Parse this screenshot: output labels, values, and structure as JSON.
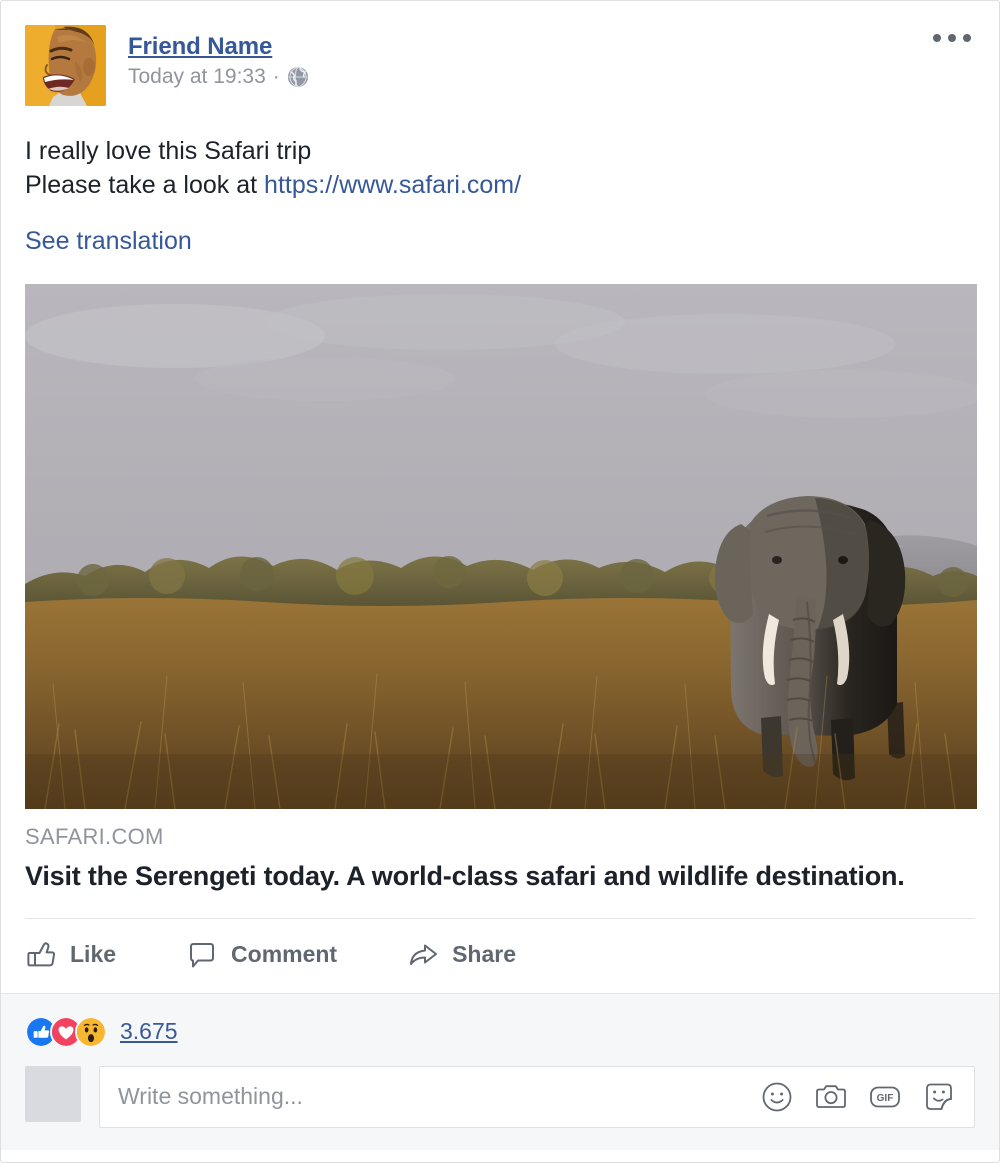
{
  "post": {
    "author": {
      "name": "Friend Name",
      "avatar_alt": "profile-photo-laughing-woman",
      "avatar_bg": "#e8a020"
    },
    "meta": {
      "timestamp": "Today at 19:33",
      "separator": "·",
      "privacy_icon": "globe-icon",
      "privacy_label": "Public"
    },
    "more_menu_label": "More options",
    "message": {
      "line1": "I really love this Safari trip",
      "line2_prefix": "Please take a look at ",
      "link_text": "https://www.safari.com/",
      "translate_label": "See translation"
    },
    "photo": {
      "alt": "elephant-in-savanna-grassland",
      "sky_color": "#b4b2b7",
      "grass_color": "#8a6432",
      "tree_color": "#6e6a43"
    },
    "attachment": {
      "domain": "SAFARI.COM",
      "title": "Visit the Serengeti today. A world-class safari and wildlife destination."
    },
    "actions": [
      {
        "key": "like",
        "label": "Like",
        "icon": "thumbs-up-icon"
      },
      {
        "key": "comment",
        "label": "Comment",
        "icon": "comment-bubble-icon"
      },
      {
        "key": "share",
        "label": "Share",
        "icon": "share-arrow-icon"
      }
    ],
    "reactions": {
      "count": "3.675",
      "items": [
        {
          "key": "like",
          "icon": "reaction-like-icon",
          "color": "#1877f2"
        },
        {
          "key": "love",
          "icon": "reaction-love-icon",
          "color": "#f3425f"
        },
        {
          "key": "wow",
          "icon": "reaction-wow-icon",
          "color": "#f7b125"
        }
      ]
    },
    "composer": {
      "placeholder": "Write something...",
      "value": "",
      "avatar_alt": "your-profile-photo",
      "tools": [
        {
          "key": "emoji",
          "icon": "emoji-smiley-icon",
          "label": "Emoji"
        },
        {
          "key": "photo",
          "icon": "camera-icon",
          "label": "Photo"
        },
        {
          "key": "gif",
          "icon": "gif-icon",
          "label": "GIF"
        },
        {
          "key": "sticker",
          "icon": "sticker-icon",
          "label": "Sticker"
        }
      ],
      "gif_text": "GIF"
    }
  },
  "colors": {
    "brand_blue": "#365899",
    "text_dark": "#1d2129",
    "text_muted": "#90949c",
    "action_gray": "#616770",
    "panel_bg": "#f6f7f9",
    "border": "#dddfe2"
  }
}
